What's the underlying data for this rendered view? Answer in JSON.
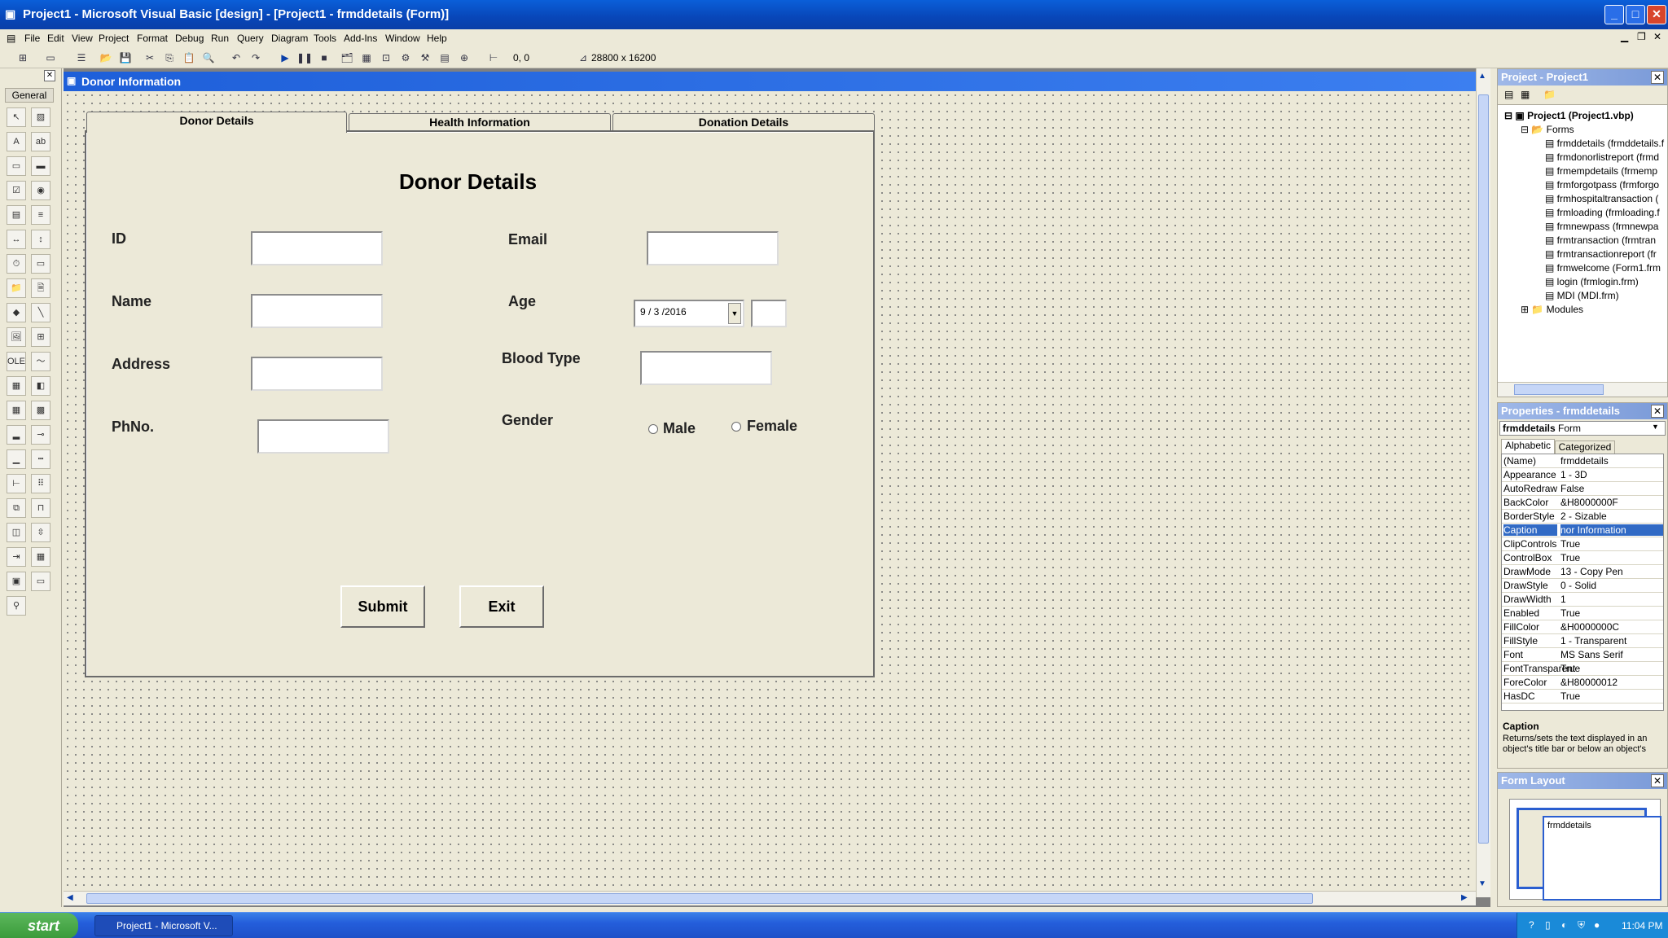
{
  "window": {
    "title": "Project1 - Microsoft Visual Basic [design] - [Project1 - frmddetails (Form)]"
  },
  "menu": [
    "File",
    "Edit",
    "View",
    "Project",
    "Format",
    "Debug",
    "Run",
    "Query",
    "Diagram",
    "Tools",
    "Add-Ins",
    "Window",
    "Help"
  ],
  "toolbar": {
    "position": "0, 0",
    "size": "28800 x 16200"
  },
  "toolbox": {
    "title": "General"
  },
  "form": {
    "caption": "Donor Information",
    "tabs": [
      "Donor Details",
      "Health Information",
      "Donation Details"
    ],
    "heading": "Donor Details",
    "labels": {
      "id": "ID",
      "name": "Name",
      "address": "Address",
      "phone": "PhNo.",
      "email": "Email",
      "age": "Age",
      "blood": "Blood Type",
      "gender": "Gender"
    },
    "date_value": "9 / 3 /2016",
    "radio": {
      "male": "Male",
      "female": "Female"
    },
    "buttons": {
      "submit": "Submit",
      "exit": "Exit"
    }
  },
  "project": {
    "title": "Project - Project1",
    "root": "Project1 (Project1.vbp)",
    "forms_folder": "Forms",
    "forms": [
      "frmddetails (frmddetails.f",
      "frmdonorlistreport (frmd",
      "frmempdetails (frmemp",
      "frmforgotpass (frmforgo",
      "frmhospitaltransaction (",
      "frmloading (frmloading.f",
      "frmnewpass (frmnewpa",
      "frmtransaction (frmtran",
      "frmtransactionreport (fr",
      "frmwelcome (Form1.frm",
      "login (frmlogin.frm)",
      "MDI (MDI.frm)"
    ],
    "modules_folder": "Modules"
  },
  "properties": {
    "title": "Properties - frmddetails",
    "object": "frmddetails",
    "object_type": "Form",
    "tabs": [
      "Alphabetic",
      "Categorized"
    ],
    "rows": [
      {
        "name": "(Name)",
        "value": "frmddetails"
      },
      {
        "name": "Appearance",
        "value": "1 - 3D"
      },
      {
        "name": "AutoRedraw",
        "value": "False"
      },
      {
        "name": "BackColor",
        "value": "&H8000000F"
      },
      {
        "name": "BorderStyle",
        "value": "2 - Sizable"
      },
      {
        "name": "Caption",
        "value": "nor Information"
      },
      {
        "name": "ClipControls",
        "value": "True"
      },
      {
        "name": "ControlBox",
        "value": "True"
      },
      {
        "name": "DrawMode",
        "value": "13 - Copy Pen"
      },
      {
        "name": "DrawStyle",
        "value": "0 - Solid"
      },
      {
        "name": "DrawWidth",
        "value": "1"
      },
      {
        "name": "Enabled",
        "value": "True"
      },
      {
        "name": "FillColor",
        "value": "&H0000000C"
      },
      {
        "name": "FillStyle",
        "value": "1 - Transparent"
      },
      {
        "name": "Font",
        "value": "MS Sans Serif"
      },
      {
        "name": "FontTransparent",
        "value": "True"
      },
      {
        "name": "ForeColor",
        "value": "&H80000012"
      },
      {
        "name": "HasDC",
        "value": "True"
      }
    ],
    "desc_title": "Caption",
    "desc_text": "Returns/sets the text displayed in an object's title bar or below an object's"
  },
  "form_layout": {
    "title": "Form Layout",
    "form_name": "frmddetails"
  },
  "taskbar": {
    "start": "start",
    "task": "Project1 - Microsoft V...",
    "clock": "11:04 PM"
  }
}
